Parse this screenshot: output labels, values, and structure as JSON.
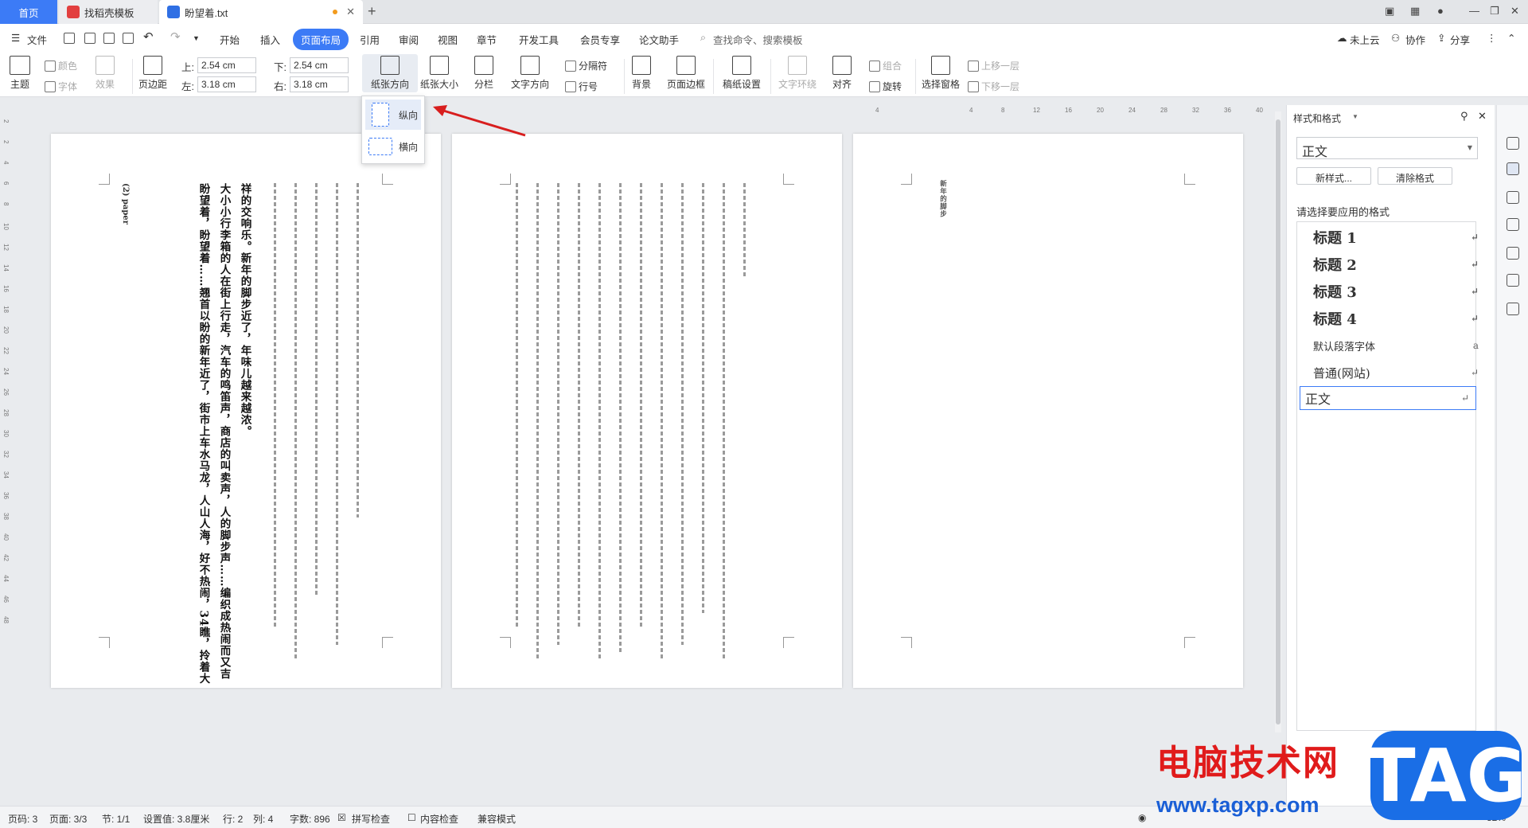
{
  "tabs": {
    "home": "首页",
    "template": "找稻壳模板",
    "document": "盼望着.txt"
  },
  "menu": {
    "file": "文件",
    "items": [
      "开始",
      "插入",
      "页面布局",
      "引用",
      "审阅",
      "视图",
      "章节",
      "开发工具",
      "会员专享",
      "论文助手"
    ],
    "search_placeholder": "查找命令、搜索模板",
    "cloud": "未上云",
    "collab": "协作",
    "share": "分享"
  },
  "ribbon": {
    "theme": "主题",
    "color": "颜色",
    "font": "字体",
    "effect": "效果",
    "margins": "页边距",
    "top_label": "上:",
    "top_value": "2.54 cm",
    "bottom_label": "下:",
    "bottom_value": "2.54 cm",
    "left_label": "左:",
    "left_value": "3.18 cm",
    "right_label": "右:",
    "right_value": "3.18 cm",
    "orientation": "纸张方向",
    "size": "纸张大小",
    "columns": "分栏",
    "text_direction": "文字方向",
    "breaks": "分隔符",
    "line_numbers": "行号",
    "background": "背景",
    "page_border": "页面边框",
    "grid_setup": "稿纸设置",
    "text_wrap": "文字环绕",
    "align": "对齐",
    "group": "组合",
    "rotate": "旋转",
    "selection_pane": "选择窗格",
    "bring_forward": "上移一层",
    "send_backward": "下移一层"
  },
  "orientation_menu": {
    "portrait": "纵向",
    "landscape": "横向"
  },
  "ruler_top": [
    "4",
    "4",
    "8",
    "12",
    "16",
    "20",
    "24",
    "28",
    "32",
    "36",
    "40"
  ],
  "ruler_left": [
    "2",
    "2",
    "4",
    "6",
    "8",
    "10",
    "12",
    "14",
    "16",
    "18",
    "20",
    "22",
    "24",
    "26",
    "28",
    "30",
    "32",
    "34",
    "36",
    "38",
    "40",
    "42",
    "44",
    "46",
    "48"
  ],
  "page1": {
    "columns": [
      "大小小行李箱的人在街上行走，汽车的鸣笛声，商店的叫卖声，人的脚步声……编织成热闹而又吉",
      "盼望着，盼望着……翘首以盼的新年近了，街市上车水马龙，人山人海，好不热闹，34瞧，拎着大",
      "祥的交响乐。新年的脚步近了，年味儿越来越浓。",
      "(2) paper"
    ]
  },
  "page3": {
    "text": "新年的脚步"
  },
  "stylepane": {
    "title": "样式和格式",
    "current": "正文",
    "new_style": "新样式...",
    "clear_format": "清除格式",
    "prompt": "请选择要应用的格式",
    "styles": [
      "标题 1",
      "标题 2",
      "标题 3",
      "标题 4",
      "默认段落字体",
      "普通(网站)",
      "正文"
    ]
  },
  "status": {
    "page_no": "页码: 3",
    "pages": "页面: 3/3",
    "section": "节: 1/1",
    "setting": "设置值: 3.8厘米",
    "row": "行: 2",
    "col": "列: 4",
    "words": "字数: 896",
    "spell": "拼写检查",
    "content_check": "内容检查",
    "compat": "兼容模式",
    "zoom": "82%"
  },
  "watermark": {
    "text": "电脑技术网",
    "url": "www.tagxp.com",
    "tag": "TAG"
  },
  "colors": {
    "accent": "#3c7bf6",
    "arrow": "#d81e1e"
  }
}
